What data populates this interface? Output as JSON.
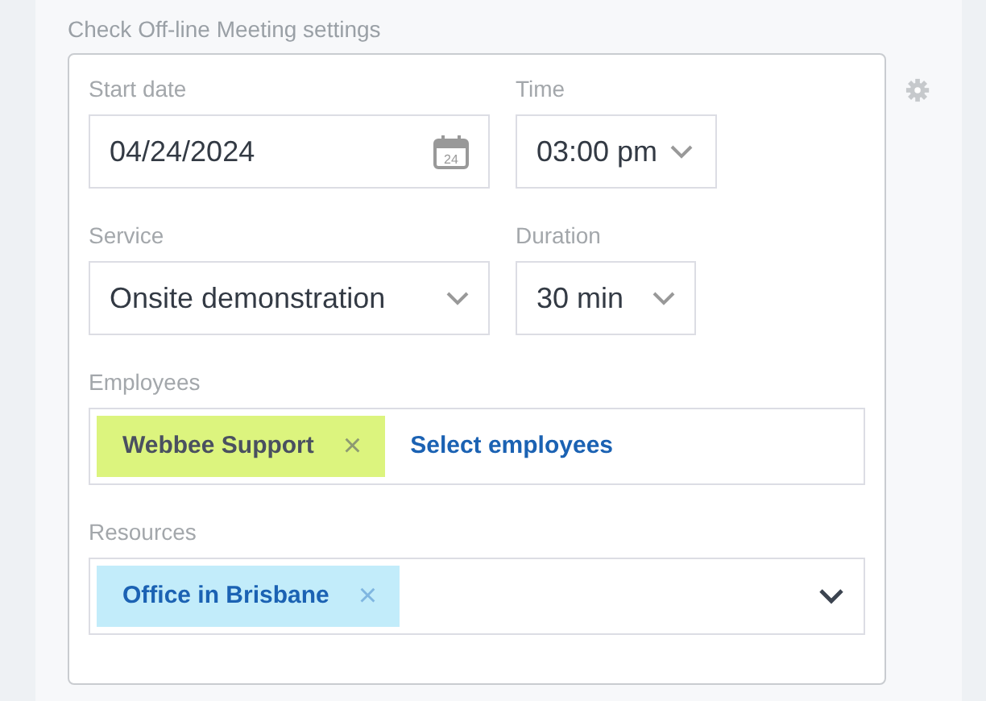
{
  "title": "Check Off-line Meeting settings",
  "start_date": {
    "label": "Start date",
    "value": "04/24/2024",
    "icon_text": "24"
  },
  "time": {
    "label": "Time",
    "value": "03:00 pm"
  },
  "service": {
    "label": "Service",
    "value": "Onsite demonstration"
  },
  "duration": {
    "label": "Duration",
    "value": "30 min"
  },
  "employees": {
    "label": "Employees",
    "tags": [
      {
        "text": "Webbee Support",
        "color": "#dcf47e",
        "remove": "×"
      }
    ],
    "link": "Select employees"
  },
  "resources": {
    "label": "Resources",
    "tags": [
      {
        "text": "Office in Brisbane",
        "color": "#c2ecfa",
        "remove": "×"
      }
    ]
  }
}
